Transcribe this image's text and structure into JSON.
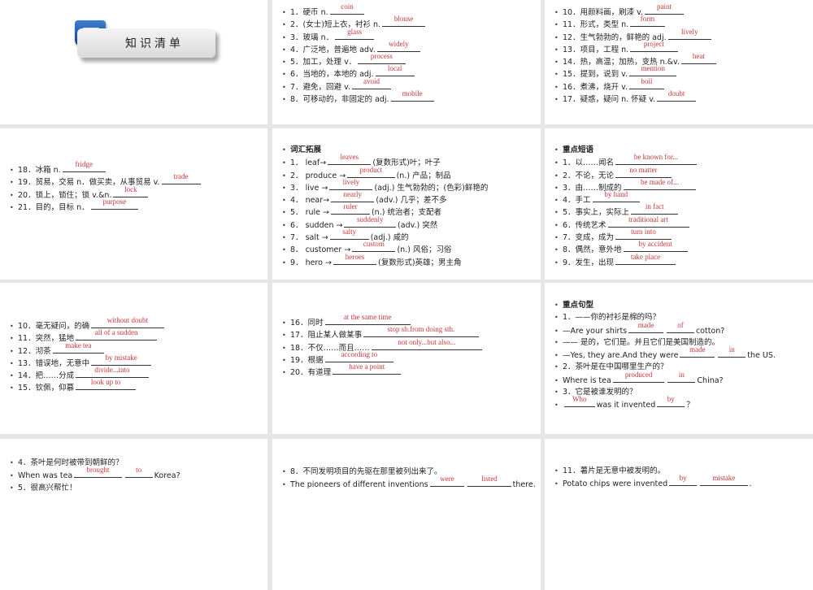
{
  "title_slide": {
    "title": "知识清单",
    "icon": "book-folder-icon"
  },
  "slides": [
    {
      "id": "s2",
      "lines": [
        [
          "1．硬币 n.",
          {
            "a": "coin"
          }
        ],
        [
          "2．(女士)短上衣，衬衫 n.",
          {
            "a": "blouse"
          }
        ],
        [
          "3．玻璃 n．",
          {
            "a": "glass"
          }
        ],
        [
          "4．广泛地，普遍地 adv.",
          {
            "a": "widely"
          }
        ],
        [
          "5．加工，处理 v．",
          {
            "a": "process"
          }
        ],
        [
          "6．当地的，本地的 adj.",
          {
            "a": "local"
          }
        ],
        [
          "7．避免，回避 v.",
          {
            "a": "avoid"
          }
        ],
        [
          "8．可移动的，非固定的 adj.",
          {
            "a": "mobile"
          }
        ]
      ]
    },
    {
      "id": "s3",
      "lines": [
        [
          "10．用颜料画，刷漆 v.",
          {
            "a": "paint"
          }
        ],
        [
          "11．形式，类型 n.",
          {
            "a": "form"
          }
        ],
        [
          "12．生气勃勃的，鲜艳的 adj.",
          {
            "a": "lively"
          }
        ],
        [
          "13．项目，工程 n.",
          {
            "a": "project"
          }
        ],
        [
          "14．热，高温；加热，变热 n.&v.",
          {
            "a": "heat"
          }
        ],
        [
          "15．提到，说到 v.",
          {
            "a": "mention"
          }
        ],
        [
          "16．煮沸，烧开 v.",
          {
            "a": "boil"
          }
        ],
        [
          "17．疑惑，疑问 n. 怀疑 v.",
          {
            "a": "doubt"
          }
        ]
      ]
    },
    {
      "id": "s4",
      "lines": [
        [
          "18．冰箱 n.",
          {
            "a": "fridge"
          }
        ],
        [
          "19．贸易，交易 n．做买卖，从事贸易 v.",
          {
            "a": "trade"
          }
        ],
        [
          "20．锁上，锁住；锁 v.&n.",
          {
            "a": "lock"
          }
        ],
        [
          "21．目的，目标 n．",
          {
            "a": "purpose"
          }
        ]
      ]
    },
    {
      "id": "s5",
      "lines": [
        [
          {
            "b": "词汇拓展"
          }
        ],
        [
          "1． leaf→",
          {
            "a": "leaves"
          },
          "(复数形式)叶；叶子"
        ],
        [
          "2． produce →",
          {
            "a": "product"
          },
          "(n.) 产品；制品"
        ],
        [
          "3． live →",
          {
            "a": "lively"
          },
          "(adj.) 生气勃勃的；(色彩)鲜艳的"
        ],
        [
          "4． near→",
          {
            "a": "nearly"
          },
          "(adv.) 几乎；差不多"
        ],
        [
          "5． rule →",
          {
            "a": "ruler"
          },
          "(n.) 统治者；支配者"
        ],
        [
          "6． sudden →",
          {
            "a": "suddenly"
          },
          "(adv.) 突然"
        ],
        [
          "7． salt →",
          {
            "a": "salty"
          },
          "(adj.) 咸的"
        ],
        [
          "8． customer →",
          {
            "a": "custom"
          },
          "(n.) 风俗；习俗"
        ],
        [
          "9． hero →",
          {
            "a": "heroes"
          },
          "(复数形式)英雄；男主角"
        ]
      ]
    },
    {
      "id": "s6",
      "lines": [
        [
          {
            "b": "重点短语"
          }
        ],
        [
          "1．以……闻名",
          {
            "a": "be known for..."
          }
        ],
        [
          "2．不论，无论",
          {
            "a": "no matter"
          }
        ],
        [
          "3．由……制成的",
          {
            "a": "be made of..."
          }
        ],
        [
          "4．手工",
          {
            "a": "by hand"
          }
        ],
        [
          "5．事实上，实际上",
          {
            "a": "in fact"
          }
        ],
        [
          "6．传统艺术",
          {
            "a": "traditional art"
          }
        ],
        [
          "7．变成，成为",
          {
            "a": "turn into"
          }
        ],
        [
          "8．偶然，意外地",
          {
            "a": "by accident"
          }
        ],
        [
          "9．发生，出现",
          {
            "a": "take place"
          }
        ]
      ]
    },
    {
      "id": "s7",
      "lines": [
        [
          "10．毫无疑问，的确",
          {
            "a": "without doubt"
          }
        ],
        [
          "11．突然，猛地",
          {
            "a": "all of a sudden"
          }
        ],
        [
          "12．沏茶",
          {
            "a": "make tea"
          }
        ],
        [
          "13．错误地，无意中",
          {
            "a": "by mistake"
          }
        ],
        [
          "14．把……分成",
          {
            "a": "divide...into"
          }
        ],
        [
          "15．钦佩，仰慕",
          {
            "a": "look up to"
          }
        ]
      ]
    },
    {
      "id": "s8",
      "lines": [
        [
          "16．同时",
          {
            "a": "at the same time"
          }
        ],
        [
          "17．阻止某人做某事",
          {
            "a": "stop sb.from doing sth."
          }
        ],
        [
          "18．不仅……而且……",
          {
            "a": "not only...but also..."
          }
        ],
        [
          "19．根据",
          {
            "a": "according to"
          }
        ],
        [
          "20．有道理",
          {
            "a": "have a point"
          }
        ]
      ]
    },
    {
      "id": "s9",
      "lines": [
        [
          {
            "b": "重点句型"
          }
        ],
        [
          "1．——你的衬衫是棉的吗？"
        ],
        [
          "—Are your shirts",
          {
            "a": "made"
          },
          {
            "a": "of"
          },
          "cotton?"
        ],
        [
          "—— 是的，它们是。并且它们是美国制造的。"
        ],
        [
          "—Yes, they are.And they were",
          {
            "a": "made"
          },
          {
            "a": "in"
          },
          "the US."
        ],
        [
          "2．茶叶是在中国哪里生产的？"
        ],
        [
          "Where is tea",
          {
            "a": "produced"
          },
          {
            "a": "in"
          },
          "China?"
        ],
        [
          "3．它是被谁发明的？"
        ],
        [
          {
            "a": "Who"
          },
          "was it invented",
          {
            "a": "by"
          },
          "？"
        ]
      ]
    },
    {
      "id": "s10",
      "lines": [
        [
          "4．茶叶是何时被带到朝鲜的？"
        ],
        [
          "When was tea",
          {
            "a": "brought"
          },
          {
            "a": "to"
          },
          "Korea?"
        ],
        [
          "5．很高兴帮忙！"
        ]
      ]
    },
    {
      "id": "s11",
      "lines": [
        [
          "8．不同发明项目的先驱在那里被列出来了。"
        ],
        [
          "The pioneers of different inventions",
          {
            "a": "were"
          },
          {
            "a": "listed"
          },
          "there."
        ]
      ]
    },
    {
      "id": "s12",
      "lines": [
        [
          "11．薯片是无意中被发明的。"
        ],
        [
          "Potato chips were invented",
          {
            "a": "by"
          },
          {
            "a": "mistake"
          },
          "."
        ]
      ]
    }
  ]
}
